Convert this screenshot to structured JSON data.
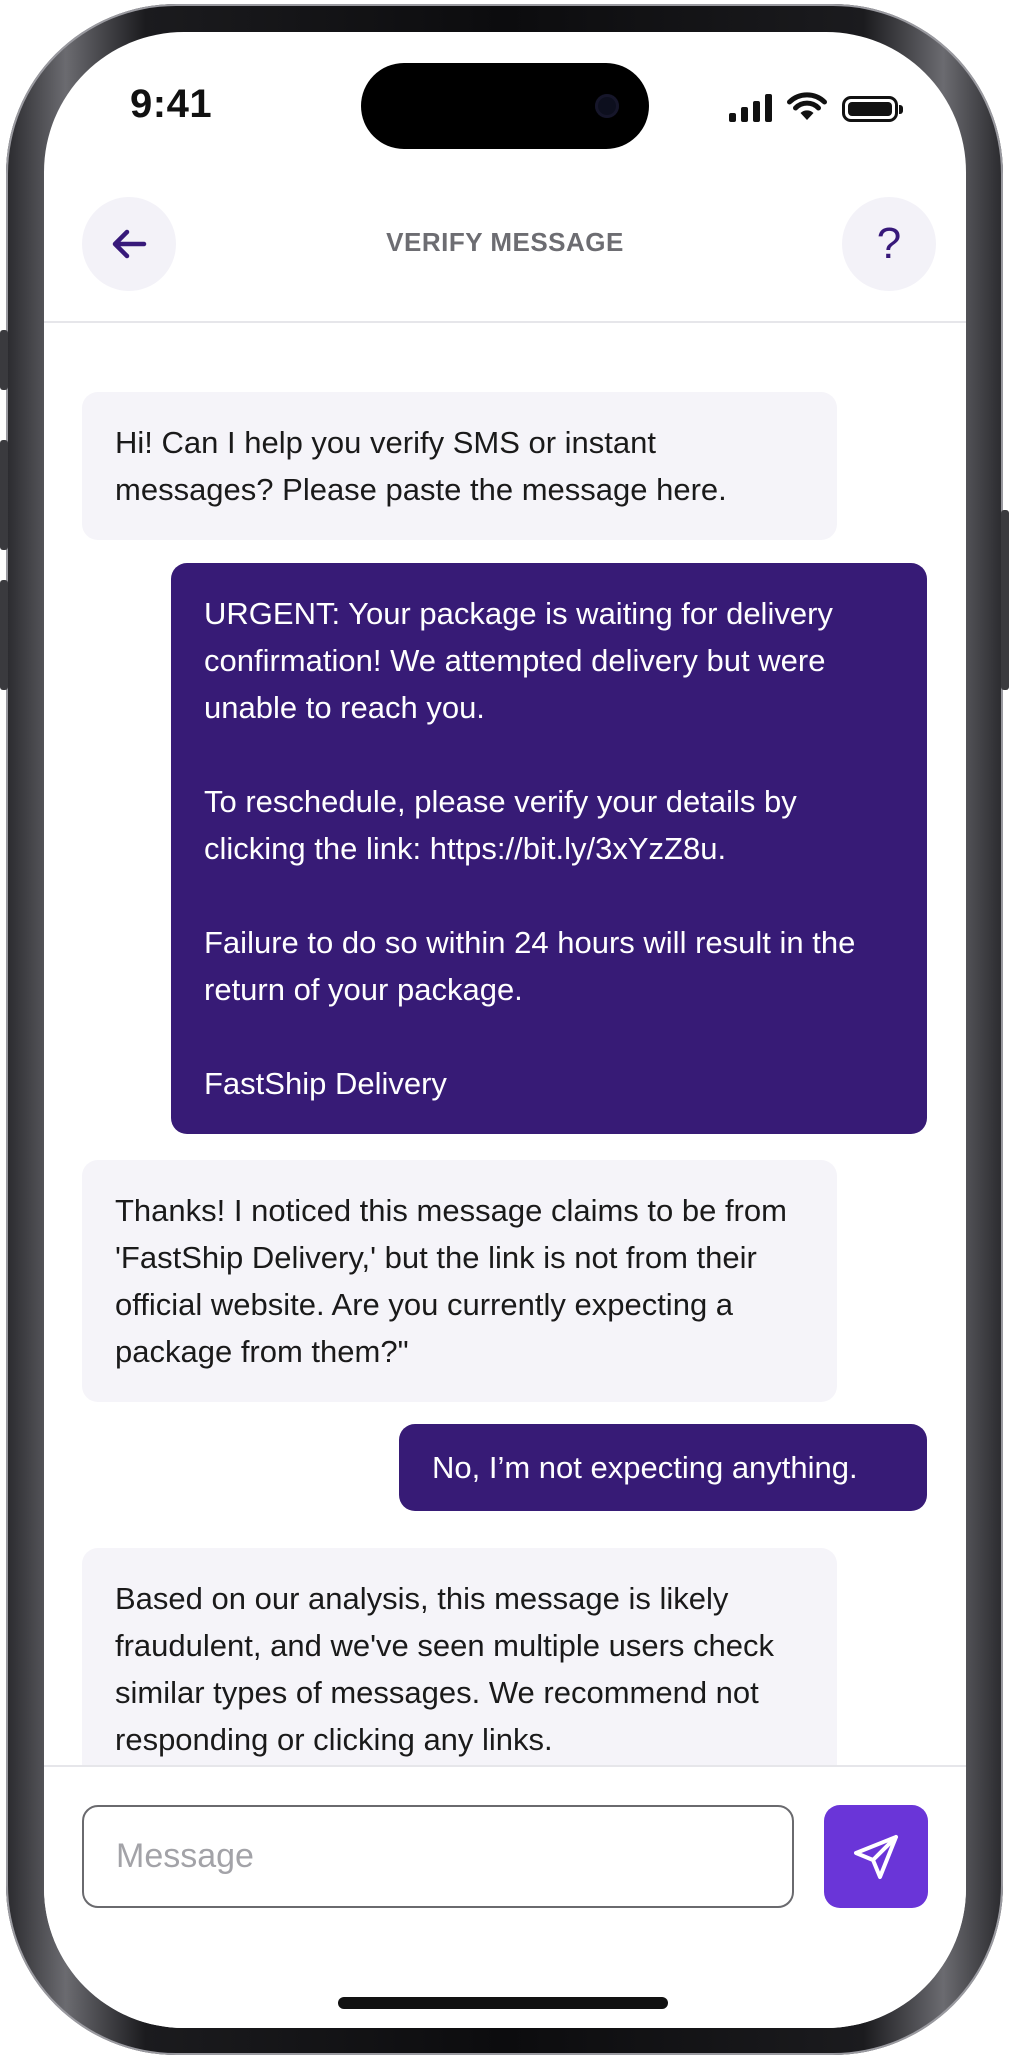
{
  "status_bar": {
    "time": "9:41"
  },
  "header": {
    "title": "VERIFY MESSAGE",
    "back_icon": "arrow-left-icon",
    "help_label": "?"
  },
  "messages": [
    {
      "sender": "bot",
      "text": "Hi! Can I help you verify SMS or instant messages? Please paste the message here."
    },
    {
      "sender": "user",
      "text": "URGENT: Your package is waiting for delivery confirmation! We attempted delivery but were unable to reach you.\n\nTo reschedule, please verify your details by clicking the link: https://bit.ly/3xYzZ8u.\n\nFailure to do so within 24 hours will result in the return of your package.\n\nFastShip Delivery"
    },
    {
      "sender": "bot",
      "text": "Thanks! I noticed this message claims to be from 'FastShip Delivery,' but the link is not from their official website. Are you currently expecting a package from them?\""
    },
    {
      "sender": "user",
      "text": "No, I’m not expecting anything."
    },
    {
      "sender": "bot",
      "text": "Based on our analysis, this message is likely fraudulent, and we've seen multiple users check similar types of messages. We recommend not responding or clicking any links."
    }
  ],
  "composer": {
    "placeholder": "Message",
    "value": "",
    "send_icon": "send-icon"
  },
  "colors": {
    "user_bubble": "#371b76",
    "bot_bubble": "#f5f4f9",
    "send_button": "#6a35d8",
    "accent": "#37197a"
  }
}
